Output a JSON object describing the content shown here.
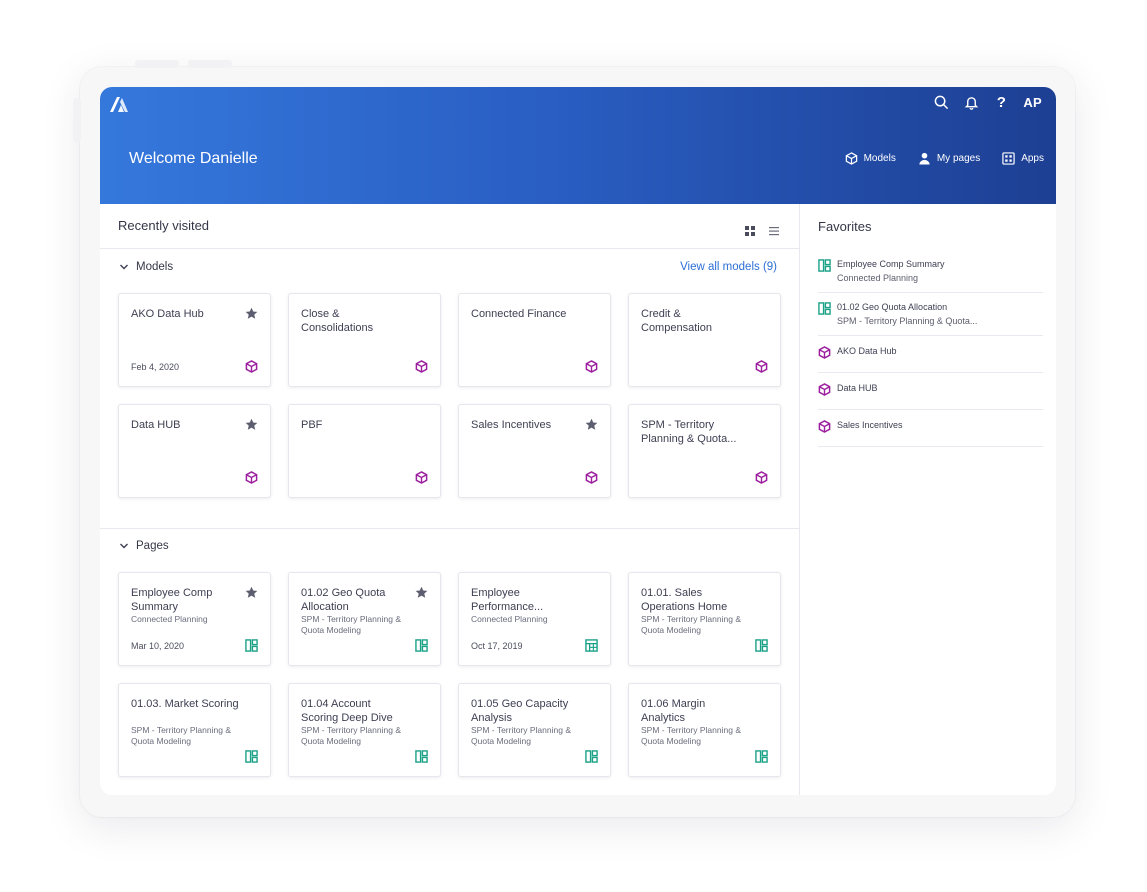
{
  "header": {
    "welcome": "Welcome Danielle",
    "avatar": "AP",
    "help": "?",
    "nav": [
      {
        "label": "Models",
        "icon": "cube-icon"
      },
      {
        "label": "My pages",
        "icon": "user-icon"
      },
      {
        "label": "Apps",
        "icon": "apps-grid-icon"
      }
    ]
  },
  "recently_visited": {
    "title": "Recently visited",
    "models_section": {
      "label": "Models",
      "view_all": "View all models (9)",
      "cards": [
        {
          "title": "AKO Data Hub",
          "date": "Feb 4, 2020",
          "starred": true
        },
        {
          "title": "Close & Consolidations",
          "date": "",
          "starred": false
        },
        {
          "title": "Connected Finance",
          "date": "",
          "starred": false
        },
        {
          "title": "Credit & Compensation",
          "date": "",
          "starred": false
        },
        {
          "title": "Data HUB",
          "date": "",
          "starred": true
        },
        {
          "title": "PBF",
          "date": "",
          "starred": false
        },
        {
          "title": "Sales Incentives",
          "date": "",
          "starred": true
        },
        {
          "title": "SPM - Territory Planning & Quota...",
          "date": "",
          "starred": false
        }
      ]
    },
    "pages_section": {
      "label": "Pages",
      "cards": [
        {
          "title": "Employee Comp Summary",
          "sub": "Connected Planning",
          "date": "Mar 10, 2020",
          "starred": true,
          "icon": "board"
        },
        {
          "title": "01.02 Geo Quota Allocation",
          "sub": "SPM - Territory Planning & Quota Modeling",
          "date": "",
          "starred": true,
          "icon": "board"
        },
        {
          "title": "Employee Performance...",
          "sub": "Connected Planning",
          "date": "Oct 17, 2019",
          "starred": false,
          "icon": "worksheet"
        },
        {
          "title": "01.01. Sales Operations Home",
          "sub": "SPM - Territory Planning & Quota Modeling",
          "date": "",
          "starred": false,
          "icon": "board"
        },
        {
          "title": "01.03. Market Scoring",
          "sub": "SPM - Territory Planning & Quota Modeling",
          "date": "",
          "starred": false,
          "icon": "board"
        },
        {
          "title": "01.04 Account Scoring Deep Dive",
          "sub": "SPM - Territory Planning & Quota Modeling",
          "date": "",
          "starred": false,
          "icon": "board"
        },
        {
          "title": "01.05 Geo Capacity Analysis",
          "sub": "SPM - Territory Planning & Quota Modeling",
          "date": "",
          "starred": false,
          "icon": "board"
        },
        {
          "title": "01.06 Margin Analytics",
          "sub": "SPM - Territory Planning & Quota Modeling",
          "date": "",
          "starred": false,
          "icon": "board"
        }
      ]
    }
  },
  "favorites": {
    "title": "Favorites",
    "items": [
      {
        "title": "Employee Comp Summary",
        "sub": "Connected Planning",
        "icon": "board"
      },
      {
        "title": "01.02 Geo Quota Allocation",
        "sub": "SPM - Territory Planning & Quota...",
        "icon": "board"
      },
      {
        "title": "AKO Data Hub",
        "sub": "",
        "icon": "cube"
      },
      {
        "title": "Data HUB",
        "sub": "",
        "icon": "cube"
      },
      {
        "title": "Sales Incentives",
        "sub": "",
        "icon": "cube"
      }
    ]
  },
  "colors": {
    "header_start": "#3578dc",
    "header_end": "#1d3f93",
    "model_icon": "#9b1f9e",
    "page_icon": "#19a186",
    "star": "#5c5e70",
    "link": "#2d6fd6"
  }
}
